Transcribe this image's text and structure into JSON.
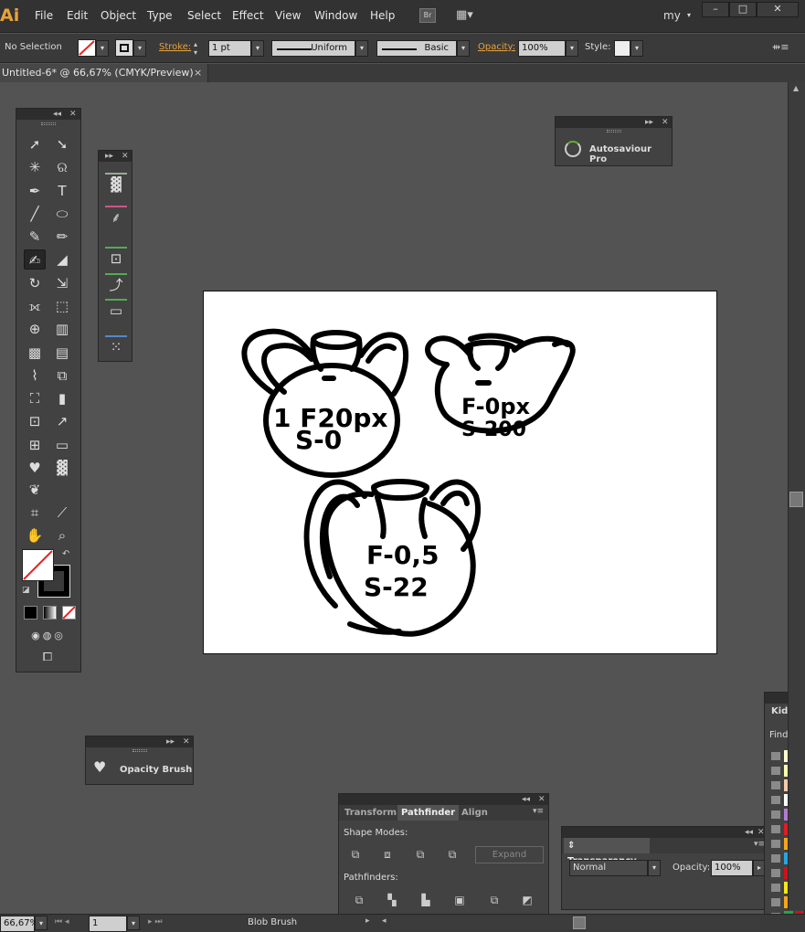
{
  "app": {
    "logo": "Ai",
    "workspace": "my"
  },
  "menu": {
    "items": [
      "File",
      "Edit",
      "Object",
      "Type",
      "Select",
      "Effect",
      "View",
      "Window",
      "Help"
    ],
    "bridge": "Br"
  },
  "window_controls": {
    "minimize": "–",
    "maximize": "□",
    "close": "✕"
  },
  "control": {
    "selection": "No Selection",
    "stroke_label": "Stroke:",
    "stroke_weight": "1 pt",
    "profile": "Uniform",
    "brush": "Basic",
    "opacity_label": "Opacity:",
    "opacity": "100%",
    "style_label": "Style:"
  },
  "document": {
    "tab_title": "Untitled-6* @ 66,67% (CMYK/Preview)",
    "close": "×"
  },
  "artwork": {
    "jug1_line1": "1 F20px",
    "jug1_line2": "S-0",
    "jug2_line1": "F-0px",
    "jug2_line2": "S-200",
    "jug3_line1": "F-0,5",
    "jug3_line2": "S-22"
  },
  "panels": {
    "autosaviour": {
      "title": "Autosaviour Pro"
    },
    "opacity_brush": {
      "title": "Opacity Brush"
    },
    "pathfinder": {
      "tabs": [
        "Transform",
        "Pathfinder",
        "Align"
      ],
      "shape_modes": "Shape Modes:",
      "expand": "Expand",
      "pathfinders": "Pathfinders:"
    },
    "transparency": {
      "title": "Transparency",
      "mode": "Normal",
      "opacity_label": "Opacity:",
      "opacity": "100%"
    },
    "swatches": {
      "title": "Kids Stu",
      "find_label": "Find:"
    }
  },
  "status": {
    "zoom": "66,67%",
    "artboard": "1",
    "tool": "Blob Brush"
  },
  "colors": {
    "accent": "#e8a23c",
    "chrome": "#323232",
    "panel": "#424242",
    "canvas": "#535353"
  }
}
